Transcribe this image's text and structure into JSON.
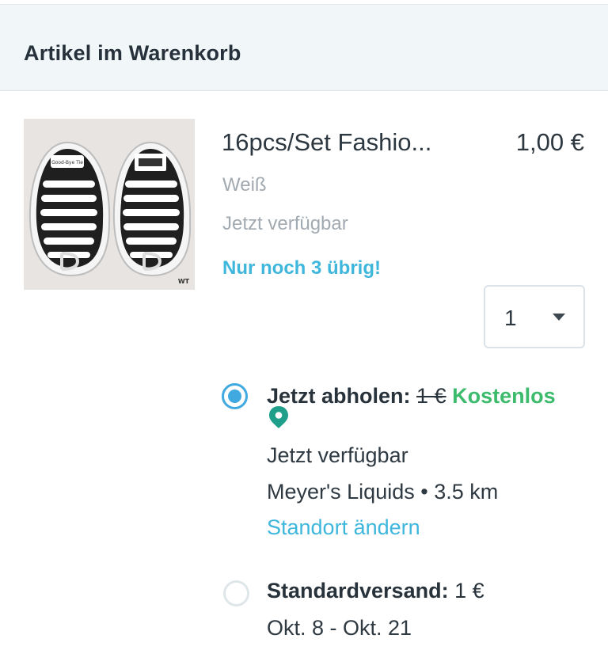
{
  "header": {
    "title": "Artikel im Warenkorb"
  },
  "product": {
    "name": "16pcs/Set Fashio...",
    "price": "1,00 €",
    "variant": "Weiß",
    "availability": "Jetzt verfügbar",
    "stock_note": "Nur noch 3 übrig!",
    "image_text": {
      "tag_left": "Good-Bye Tie",
      "watermark": "WT"
    },
    "quantity": "1"
  },
  "shipping": {
    "pickup": {
      "label": "Jetzt abholen:",
      "old_price": "1 €",
      "price": "Kostenlos",
      "availability": "Jetzt verfügbar",
      "store": "Meyer's Liquids",
      "separator": "•",
      "distance": "3.5 km",
      "change_link": "Standort ändern",
      "selected": true
    },
    "standard": {
      "label": "Standardversand:",
      "price": "1 €",
      "dates": "Okt. 8 - Okt. 21",
      "selected": false
    }
  },
  "colors": {
    "accent": "#3fb6dc",
    "radio_selected": "#3fa9e0",
    "free": "#3dbb6c",
    "pin": "#1f9f8a"
  }
}
